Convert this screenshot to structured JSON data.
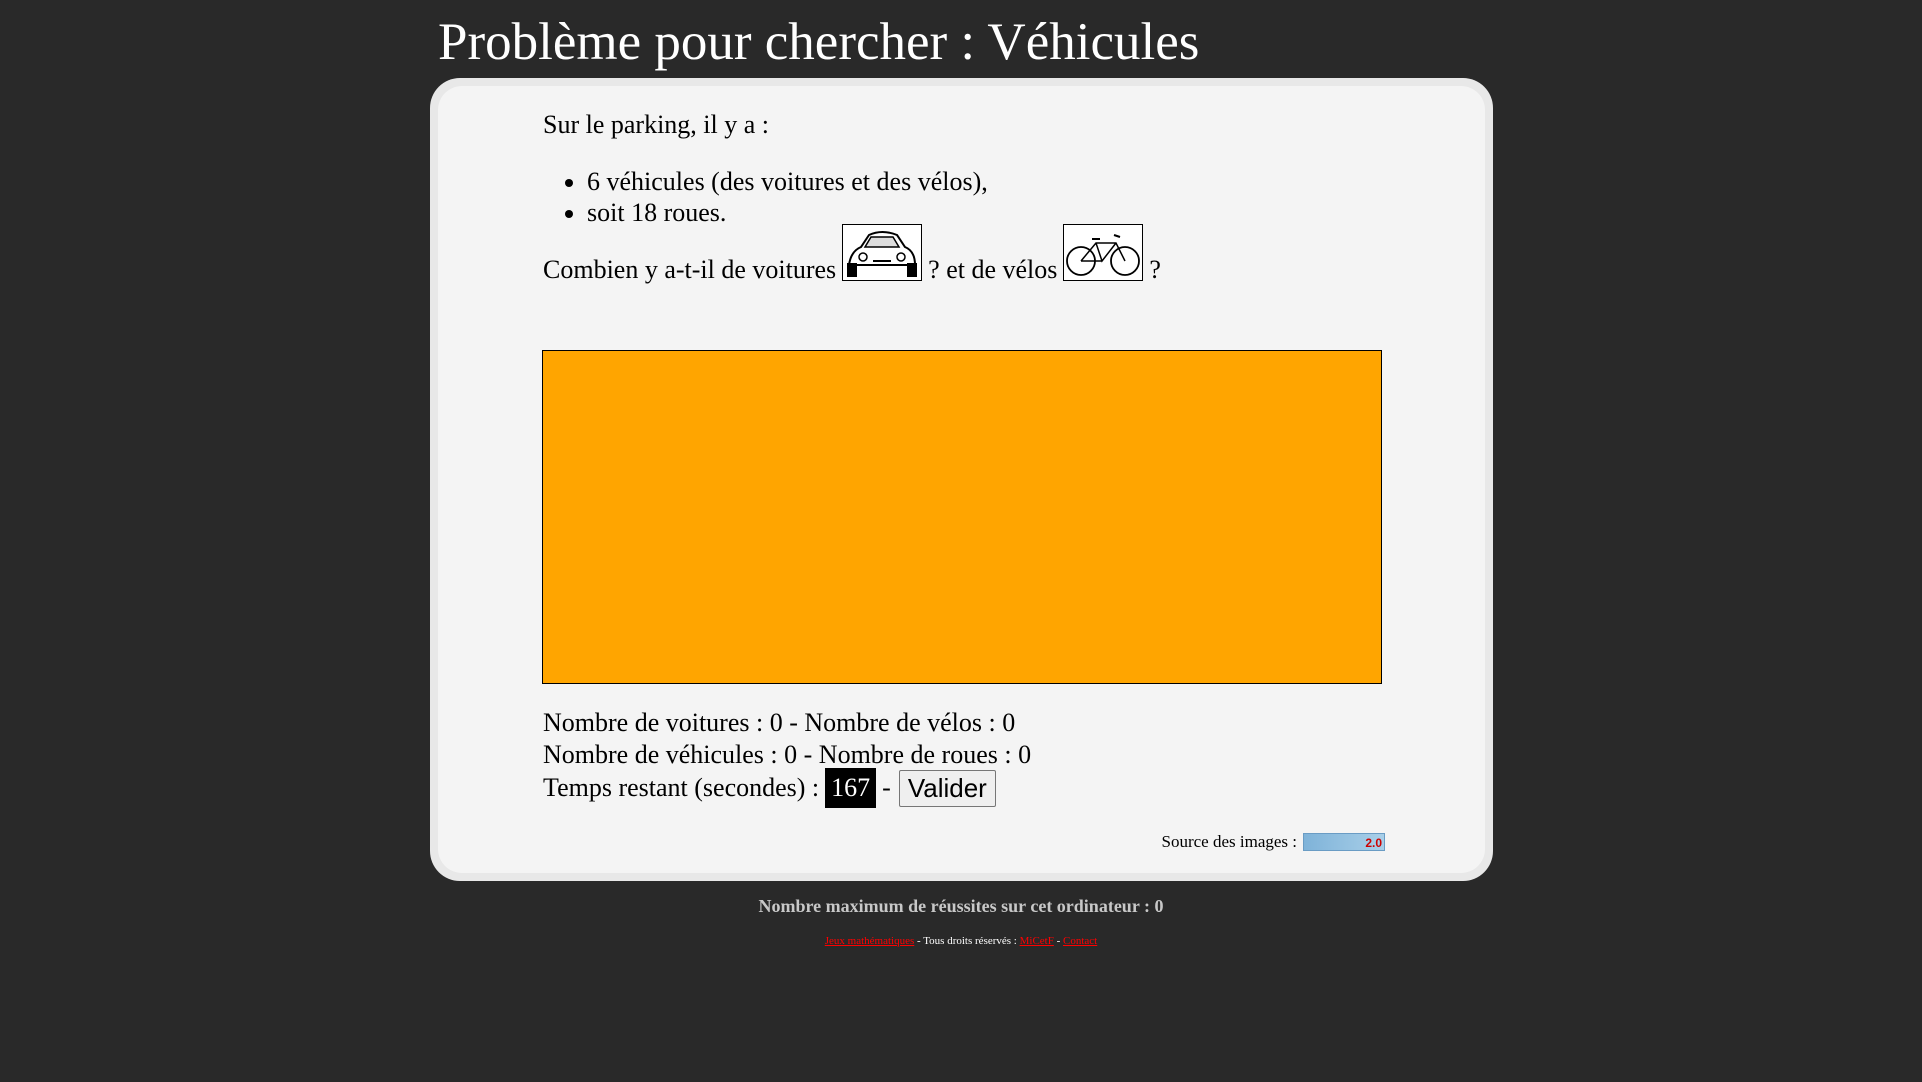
{
  "title": "Problème pour chercher : Véhicules",
  "intro": "Sur le parking, il y a :",
  "facts": [
    "6 véhicules (des voitures et des vélos),",
    "soit 18 roues."
  ],
  "question": {
    "part1": "Combien y a-t-il de voitures",
    "part2": "? et de vélos",
    "part3": "?"
  },
  "play_area": {
    "color": "#ffa500"
  },
  "stats": {
    "line1": "Nombre de voitures : 0 - Nombre de vélos : 0",
    "line2": "Nombre de véhicules : 0 - Nombre de roues : 0",
    "timer_label": "Temps restant (secondes) :",
    "timer_value": "167",
    "separator": "-",
    "validate_label": "Valider"
  },
  "source": {
    "label": "Source des images :",
    "logo_text": "2.0"
  },
  "max_score": "Nombre maximum de réussites sur cet ordinateur : 0",
  "footer": {
    "link1": "Jeux mathématiques",
    "rights": " - Tous droits réservés : ",
    "link2": "MiCetF",
    "sep": " - ",
    "link3": "Contact"
  },
  "colors": {
    "background": "#292929",
    "card": "#f4f4f4",
    "accent": "#ffa500",
    "link": "#ff0000"
  }
}
